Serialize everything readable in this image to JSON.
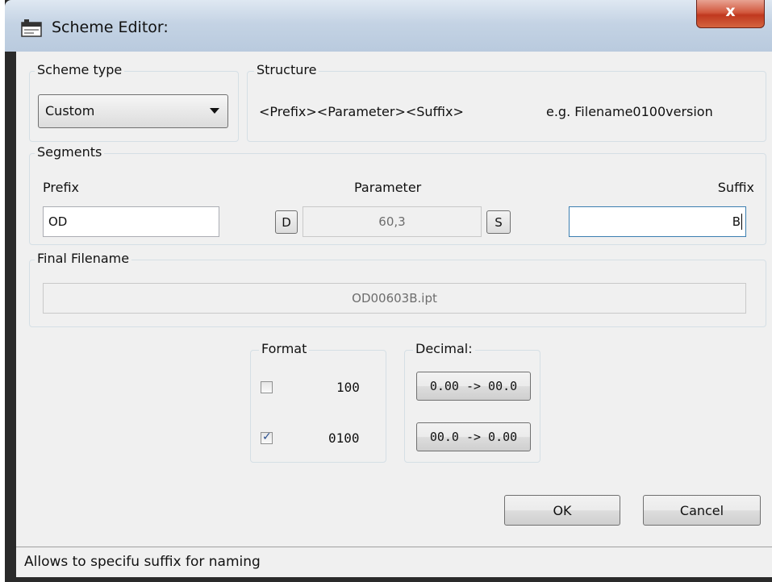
{
  "window": {
    "title": "Scheme Editor:",
    "close_label": "x"
  },
  "scheme_type": {
    "legend": "Scheme type",
    "selected": "Custom"
  },
  "structure": {
    "legend": "Structure",
    "pattern": "<Prefix><Parameter><Suffix>",
    "example": "e.g. Filename0100version"
  },
  "segments": {
    "legend": "Segments",
    "prefix_label": "Prefix",
    "prefix_value": "OD",
    "parameter_label": "Parameter",
    "parameter_value": "60,3",
    "d_button": "D",
    "s_button": "S",
    "suffix_label": "Suffix",
    "suffix_value": "B"
  },
  "final_filename": {
    "legend": "Final Filename",
    "value": "OD00603B.ipt"
  },
  "format": {
    "legend": "Format",
    "options": [
      {
        "label": "100",
        "checked": false
      },
      {
        "label": "0100",
        "checked": true
      }
    ]
  },
  "decimal": {
    "legend": "Decimal:",
    "buttons": [
      "0.00 -> 00.0",
      "00.0 -> 0.00"
    ]
  },
  "actions": {
    "ok": "OK",
    "cancel": "Cancel"
  },
  "status": {
    "text": "Allows to specifu suffix for naming"
  }
}
